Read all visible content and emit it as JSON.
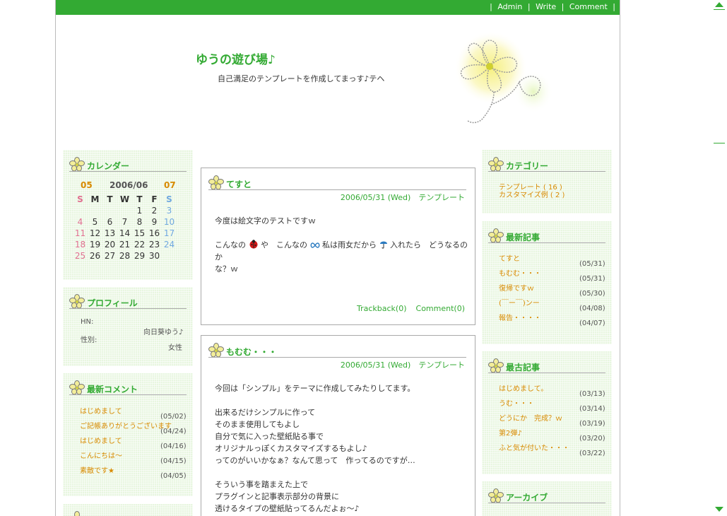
{
  "header": {
    "nav": [
      "|",
      "Admin",
      "|",
      "Write",
      "|",
      "Comment",
      "|"
    ],
    "title": "ゆうの遊び場♪",
    "subtitle": "自己満足のテンプレートを作成してまっす♪テヘ"
  },
  "colors": {
    "accent": "#33aa33",
    "link": "#d88a00",
    "panel": "#e8f6e0",
    "border": "#a9a9a9"
  },
  "calendar": {
    "title": "カレンダー",
    "prev": "05",
    "current": "2006/06",
    "next": "07",
    "weekdays": [
      "S",
      "M",
      "T",
      "W",
      "T",
      "F",
      "S"
    ],
    "weeks": [
      [
        "",
        "",
        "",
        "",
        "1",
        "2",
        "3"
      ],
      [
        "4",
        "5",
        "6",
        "7",
        "8",
        "9",
        "10"
      ],
      [
        "11",
        "12",
        "13",
        "14",
        "15",
        "16",
        "17"
      ],
      [
        "18",
        "19",
        "20",
        "21",
        "22",
        "23",
        "24"
      ],
      [
        "25",
        "26",
        "27",
        "28",
        "29",
        "30",
        ""
      ]
    ]
  },
  "profile": {
    "title": "プロフィール",
    "hn_label": "HN:",
    "hn_value": "向日葵ゆう♪",
    "gender_label": "性別:",
    "gender_value": "女性"
  },
  "recent_comments": {
    "title": "最新コメント",
    "items": [
      "はじめまして",
      "ご記帳ありがとうございます",
      "はじめまして",
      "こんにちは～",
      "素敵です★"
    ],
    "dates": [
      "(05/02)",
      "(04/24)",
      "(04/16)",
      "(04/15)",
      "(04/05)"
    ]
  },
  "posts": [
    {
      "title": "てすと",
      "meta": "2006/05/31 (Wed)　テンプレート",
      "line1": "今度は絵文字のテストですｗ",
      "line2a": "こんなの",
      "line2b": "や　こんなの",
      "line2c": "私は雨女だから",
      "line2d": "入れたら　どうなるのか",
      "line3": "な？ｗ",
      "trackback": "Trackback(0)",
      "comment": "Comment(0)"
    },
    {
      "title": "もむむ・・・",
      "meta": "2006/05/31 (Wed)　テンプレート",
      "lines": [
        "今回は「シンプル」をテーマに作成してみたりしてます。",
        "",
        "出来るだけシンプルに作って",
        "そのまま使用してもよし",
        "自分で気に入った壁紙貼る事で",
        "オリジナルっぽくカスタマイズするもよし♪",
        "ってのがいいかなぁ？なんて思って　作ってるのですが…",
        "",
        "そういう事を踏まえた上で",
        "プラグインと記事表示部分の背景に",
        "透けるタイプの壁紙貼ってるんだよぉ～♪"
      ]
    }
  ],
  "categories": {
    "title": "カテゴリー",
    "items": [
      "テンプレート ( 16 )",
      "カスタマイズ例 ( 2 )"
    ]
  },
  "recent_posts": {
    "title": "最新記事",
    "items": [
      "てすと",
      "もむむ・・・",
      "復帰ですｗ",
      "(￣ー￣)ンー",
      "報告・・・・"
    ],
    "dates": [
      "(05/31)",
      "(05/31)",
      "(05/30)",
      "(04/08)",
      "(04/07)"
    ]
  },
  "oldest_posts": {
    "title": "最古記事",
    "items": [
      "はじめまして。",
      "うむ・・・",
      "どうにか　完成？ｗ",
      "第2弾♪",
      "ふと気が付いた・・・"
    ],
    "dates": [
      "(03/13)",
      "(03/14)",
      "(03/19)",
      "(03/20)",
      "(03/22)"
    ]
  },
  "archive": {
    "title": "アーカイブ"
  }
}
